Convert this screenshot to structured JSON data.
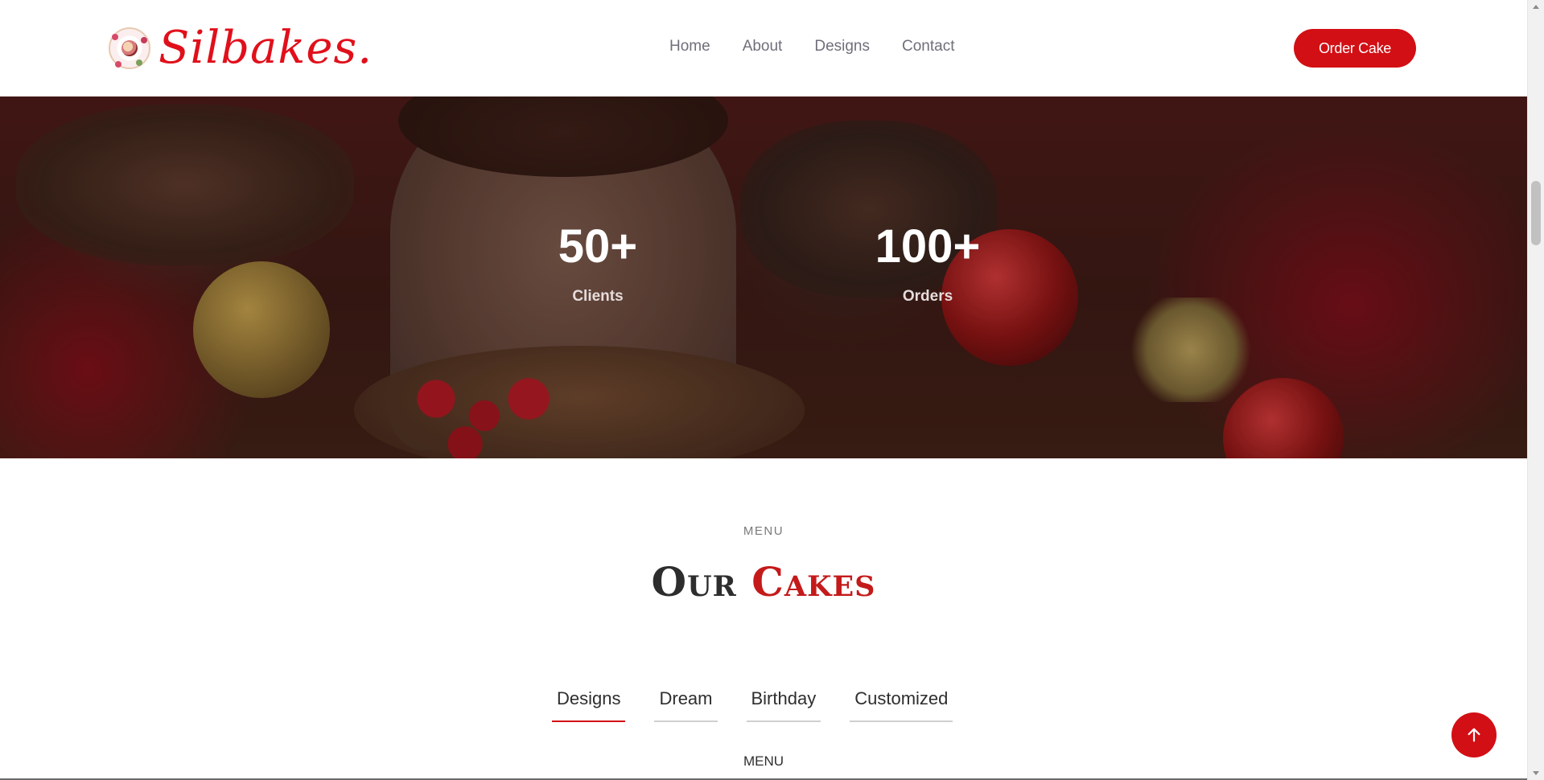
{
  "header": {
    "logo_text": "Silbakes.",
    "nav": [
      "Home",
      "About",
      "Designs",
      "Contact"
    ],
    "cta_label": "Order Cake"
  },
  "hero": {
    "stats": [
      {
        "value": "50+",
        "label": "Clients"
      },
      {
        "value": "100+",
        "label": "Orders"
      }
    ]
  },
  "menu_section": {
    "eyebrow": "MENU",
    "title_part1": "Our",
    "title_part2": "Cakes",
    "tabs": [
      "Designs",
      "Dream",
      "Birthday",
      "Customized"
    ],
    "active_tab": "Designs",
    "sub_label": "MENU"
  },
  "icons": {
    "back_to_top": "arrow-up-icon"
  },
  "colors": {
    "accent": "#d20f14",
    "nav_text": "#6f6f7a",
    "title_red": "#c41a1a"
  }
}
